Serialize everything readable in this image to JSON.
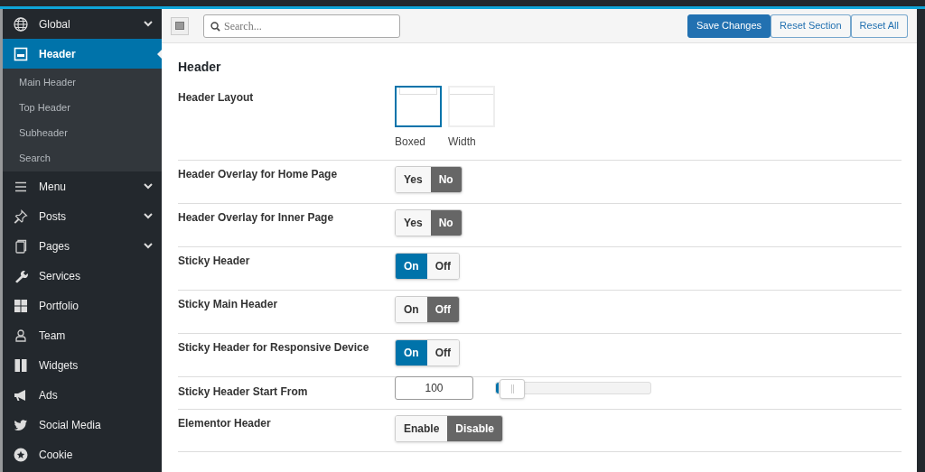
{
  "sidebar": {
    "items": [
      {
        "label": "Global",
        "expandable": true,
        "selected": false
      },
      {
        "label": "Header",
        "expandable": false,
        "selected": true,
        "children": [
          {
            "label": "Main Header"
          },
          {
            "label": "Top Header"
          },
          {
            "label": "Subheader"
          },
          {
            "label": "Search"
          }
        ]
      },
      {
        "label": "Menu",
        "expandable": true,
        "selected": false
      },
      {
        "label": "Posts",
        "expandable": true,
        "selected": false
      },
      {
        "label": "Pages",
        "expandable": true,
        "selected": false
      },
      {
        "label": "Services",
        "expandable": false,
        "selected": false
      },
      {
        "label": "Portfolio",
        "expandable": false,
        "selected": false
      },
      {
        "label": "Team",
        "expandable": false,
        "selected": false
      },
      {
        "label": "Widgets",
        "expandable": false,
        "selected": false
      },
      {
        "label": "Ads",
        "expandable": false,
        "selected": false
      },
      {
        "label": "Social Media",
        "expandable": false,
        "selected": false
      },
      {
        "label": "Cookie",
        "expandable": false,
        "selected": false
      }
    ]
  },
  "toolbar": {
    "search": {
      "placeholder": "Search..."
    },
    "buttons": [
      {
        "label": "Save Changes",
        "kind": "primary"
      },
      {
        "label": "Reset Section",
        "kind": "secondary"
      },
      {
        "label": "Reset All",
        "kind": "secondary"
      }
    ]
  },
  "section": {
    "title": "Header",
    "fields": [
      {
        "kind": "layout",
        "label": "Header Layout",
        "options": [
          {
            "label": "Boxed",
            "kind": "boxed",
            "selected": true
          },
          {
            "label": "Width",
            "kind": "full",
            "selected": false
          }
        ]
      },
      {
        "kind": "toggle",
        "label": "Header Overlay for Home Page",
        "options": [
          {
            "label": "Yes",
            "kind": "on",
            "selected": false
          },
          {
            "label": "No",
            "kind": "off",
            "selected": true
          }
        ]
      },
      {
        "kind": "toggle",
        "label": "Header Overlay for Inner Page",
        "options": [
          {
            "label": "Yes",
            "kind": "on",
            "selected": false
          },
          {
            "label": "No",
            "kind": "off",
            "selected": true
          }
        ]
      },
      {
        "kind": "toggle",
        "label": "Sticky Header",
        "options": [
          {
            "label": "On",
            "kind": "on",
            "selected": true
          },
          {
            "label": "Off",
            "kind": "off",
            "selected": false
          }
        ]
      },
      {
        "kind": "toggle",
        "label": "Sticky Main Header",
        "options": [
          {
            "label": "On",
            "kind": "on",
            "selected": false
          },
          {
            "label": "Off",
            "kind": "off",
            "selected": true
          }
        ]
      },
      {
        "kind": "toggle",
        "label": "Sticky Header for Responsive Device",
        "options": [
          {
            "label": "On",
            "kind": "on",
            "selected": true
          },
          {
            "label": "Off",
            "kind": "off",
            "selected": false
          }
        ]
      },
      {
        "kind": "slider",
        "label": "Sticky Header Start From",
        "value": "100",
        "level": 0.02
      },
      {
        "kind": "toggle",
        "label": "Elementor Header",
        "options": [
          {
            "label": "Enable",
            "kind": "on",
            "selected": false
          },
          {
            "label": "Disable",
            "kind": "off",
            "selected": true
          }
        ]
      }
    ]
  }
}
